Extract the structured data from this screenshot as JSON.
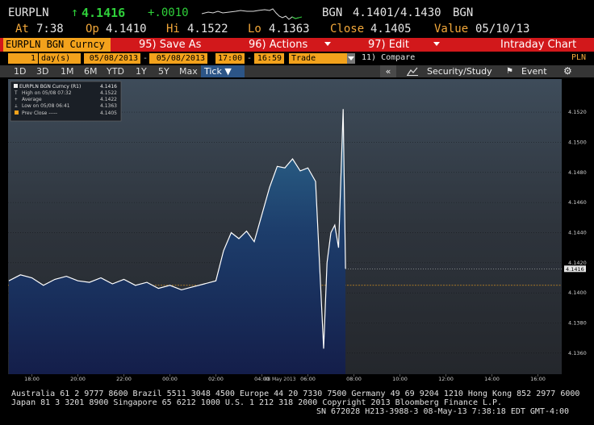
{
  "quote": {
    "ticker": "EURPLN",
    "last": "4.1416",
    "change": "+.0010",
    "source": "BGN",
    "bid_ask": "4.1401/4.1430",
    "source2": "BGN",
    "at_label": "At",
    "at_time": "7:38",
    "op_label": "Op",
    "op": "4.1410",
    "hi_label": "Hi",
    "hi": "4.1522",
    "lo_label": "Lo",
    "lo": "4.1363",
    "close_label": "Close",
    "close": "4.1405",
    "value_label": "Value",
    "value_date": "05/10/13"
  },
  "toolbar": {
    "security": "EURPLN BGN Curncy",
    "save_as": "95) Save As",
    "actions": "96) Actions",
    "edit": "97) Edit",
    "view": "Intraday Chart"
  },
  "range": {
    "period_count": "1",
    "period_unit": "day(s)",
    "start_date": "05/08/2013",
    "end_date": "05/08/2013",
    "start_time": "17:00",
    "end_time": "16:59",
    "mode": "Trade",
    "compare": "11) Compare",
    "currency": "PLN"
  },
  "timeframes": [
    "1D",
    "3D",
    "1M",
    "6M",
    "YTD",
    "1Y",
    "5Y",
    "Max"
  ],
  "active_timeframe": "Tick",
  "chart_tools": {
    "collapse": "«",
    "security_study": "Security/Study",
    "event": "Event"
  },
  "legend": {
    "series": "EURPLN BGN Curncy (R1)",
    "series_value": "4.1416",
    "high": "High on 05/08 07:32",
    "high_value": "4.1522",
    "average": "Average",
    "average_value": "4.1422",
    "low": "Low on 05/08 06:41",
    "low_value": "4.1363",
    "prev_close": "Prev Close -----",
    "prev_close_value": "4.1405"
  },
  "chart_data": {
    "type": "area",
    "x_date_label": "08 May 2013",
    "x_ticks": [
      "18:00",
      "20:00",
      "22:00",
      "00:00",
      "02:00",
      "04:00",
      "06:00",
      "08:00",
      "10:00",
      "12:00",
      "14:00",
      "16:00"
    ],
    "y_ticks": [
      "4.1520",
      "4.1500",
      "4.1480",
      "4.1460",
      "4.1440",
      "4.1420",
      "4.1400",
      "4.1380",
      "4.1360"
    ],
    "ylim": [
      4.1346,
      4.1542
    ],
    "current_value_label": "4.1416",
    "prev_close": 4.1405,
    "series": [
      {
        "name": "EURPLN BGN Curncy",
        "x": [
          "17:00",
          "17:30",
          "18:00",
          "18:30",
          "19:00",
          "19:30",
          "20:00",
          "20:30",
          "21:00",
          "21:30",
          "22:00",
          "22:30",
          "23:00",
          "23:30",
          "00:00",
          "00:30",
          "01:00",
          "01:30",
          "02:00",
          "02:20",
          "02:40",
          "03:00",
          "03:20",
          "03:40",
          "04:00",
          "04:20",
          "04:40",
          "05:00",
          "05:20",
          "05:40",
          "06:00",
          "06:20",
          "06:41",
          "06:50",
          "07:00",
          "07:10",
          "07:20",
          "07:32",
          "07:38"
        ],
        "values": [
          4.1408,
          4.1412,
          4.141,
          4.1405,
          4.1409,
          4.1411,
          4.1408,
          4.1407,
          4.141,
          4.1406,
          4.1409,
          4.1405,
          4.1407,
          4.1403,
          4.1405,
          4.1402,
          4.1404,
          4.1406,
          4.1408,
          4.1428,
          4.144,
          4.1436,
          4.1441,
          4.1434,
          4.1452,
          4.147,
          4.1484,
          4.1483,
          4.1489,
          4.1481,
          4.1483,
          4.1474,
          4.1363,
          4.142,
          4.144,
          4.1445,
          4.143,
          4.1522,
          4.1416
        ]
      }
    ]
  },
  "footer": {
    "line1": "Australia 61 2 9777 8600 Brazil 5511 3048 4500 Europe 44 20 7330 7500 Germany 49 69 9204 1210 Hong Kong 852 2977 6000",
    "line2": "Japan 81 3 3201 8900      Singapore 65 6212 1000      U.S. 1 212 318 2000      Copyright 2013 Bloomberg Finance L.P.",
    "line3": "SN 672028 H213-3988-3 08-May-13  7:38:18 EDT  GMT-4:00"
  },
  "colors": {
    "red_bar": "#d2181b",
    "amber": "#f3a83a",
    "up_green": "#2fd03a",
    "selected_tab": "#2c5587"
  }
}
